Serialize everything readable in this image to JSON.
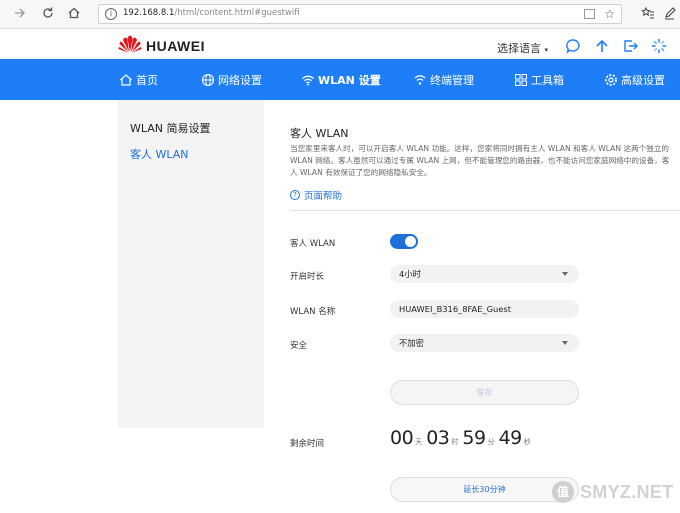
{
  "browser": {
    "url_host": "192.168.8.1",
    "url_path": "/html/content.html#guestwifi",
    "icons": [
      "arrow-right-icon",
      "refresh-icon",
      "home-icon",
      "info-icon",
      "reader-mode-icon",
      "star-icon",
      "favorites-icon",
      "pen-icon"
    ]
  },
  "header": {
    "brand": "HUAWEI",
    "language_label": "选择语言",
    "icons": [
      "chat-icon",
      "upload-icon",
      "logout-icon",
      "loading-icon"
    ]
  },
  "nav": {
    "items": [
      {
        "label": "首页",
        "icon": "home-icon"
      },
      {
        "label": "网络设置",
        "icon": "globe-icon"
      },
      {
        "label": "WLAN 设置",
        "icon": "wifi-icon",
        "active": true
      },
      {
        "label": "终端管理",
        "icon": "devices-icon"
      },
      {
        "label": "工具箱",
        "icon": "toolbox-icon"
      },
      {
        "label": "高级设置",
        "icon": "gear-icon"
      }
    ],
    "accent": "#1e7ef7"
  },
  "sidebar": {
    "items": [
      {
        "label": "WLAN 简易设置",
        "active": false
      },
      {
        "label": "客人 WLAN",
        "active": true
      }
    ]
  },
  "content": {
    "title": "客人 WLAN",
    "description": "当您家里来客人时，可以开启客人 WLAN 功能。这样，您家将同时拥有主人 WLAN 和客人 WLAN 这两个独立的 WLAN 网络。客人虽然可以通过专属 WLAN 上网，但不能管理您的路由器，也不能访问您家庭网络中的设备，客人 WLAN 有效保证了您的网络隐私安全。",
    "help_link": "页面帮助",
    "form": {
      "guest_wlan_label": "客人 WLAN",
      "guest_wlan_enabled": true,
      "duration_label": "开启时长",
      "duration_value": "4小时",
      "ssid_label": "WLAN 名称",
      "ssid_value": "HUAWEI_B316_8FAE_Guest",
      "security_label": "安全",
      "security_value": "不加密",
      "save_label": "保存",
      "remaining_label": "剩余时间",
      "countdown": {
        "days": "00",
        "days_unit": "天",
        "hours": "03",
        "hours_unit": "时",
        "minutes": "59",
        "minutes_unit": "分",
        "seconds": "49",
        "seconds_unit": "秒"
      },
      "extend_label": "延长30分钟"
    }
  },
  "watermark": {
    "badge": "值",
    "text": "SMYZ.NET"
  }
}
